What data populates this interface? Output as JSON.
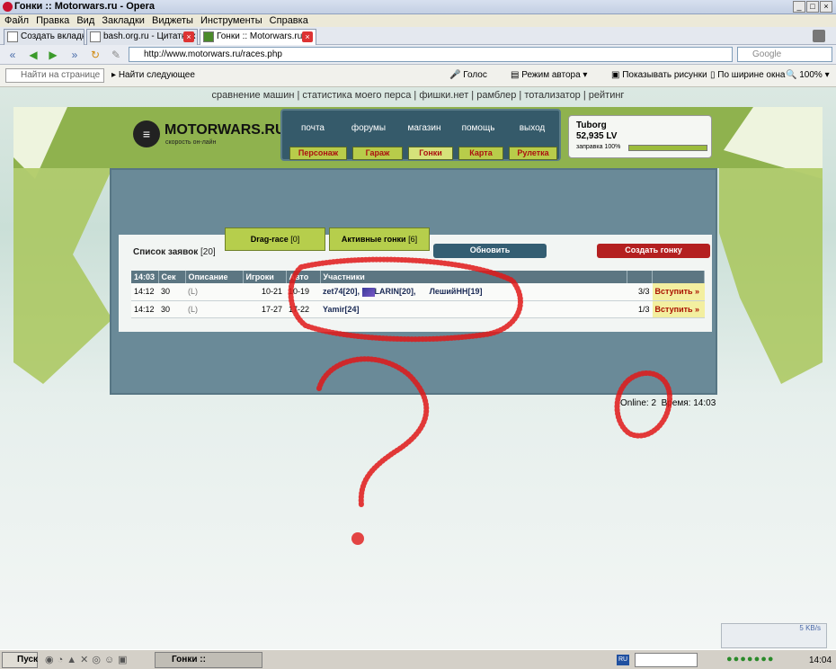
{
  "window": {
    "title": "Гонки :: Motorwars.ru - Opera"
  },
  "menu": [
    "Файл",
    "Правка",
    "Вид",
    "Закладки",
    "Виджеты",
    "Инструменты",
    "Справка"
  ],
  "tabs": [
    {
      "label": "Создать вкладку"
    },
    {
      "label": "bash.org.ru - Цитатник ..."
    },
    {
      "label": "Гонки :: Motorwars.ru"
    }
  ],
  "address": {
    "url": "http://www.motorwars.ru/races.php",
    "search_placeholder": "Google"
  },
  "toolbar2": {
    "find_placeholder": "Найти на странице",
    "find_next": "Найти следующее",
    "voice": "Голос",
    "author_mode": "Режим автора",
    "show_images": "Показывать рисунки",
    "fit_width": "По ширине окна",
    "zoom": "100%"
  },
  "site": {
    "top_links": [
      "сравнение машин",
      "статистика моего перса",
      "фишки.нет",
      "рамблер",
      "тотализатор",
      "рейтинг"
    ],
    "logo_name": "MOTORWARS.RU",
    "logo_sub": "скорость он-лайн",
    "nav_top": [
      "почта",
      "форумы",
      "магазин",
      "помощь",
      "выход"
    ],
    "nav_bottom": [
      "Персонаж",
      "Гараж",
      "Гонки",
      "Карта",
      "Рулетка"
    ],
    "user": {
      "name": "Tuborg",
      "lv": "52,935 LV",
      "fuel": "заправка 100%"
    }
  },
  "panel": {
    "list_label": "Список заявок",
    "list_count": "[20]",
    "drag_race": "Drag-race",
    "drag_count": "[0]",
    "active_races": "Активные гонки",
    "active_count": "[6]",
    "refresh": "Обновить",
    "create": "Создать гонку",
    "columns": [
      "14:03",
      "Сек",
      "Описание",
      "Игроки",
      "Авто",
      "Участники"
    ],
    "rows": [
      {
        "time": "14:12",
        "sec": "30",
        "desc": "(L)",
        "players": "10-21",
        "auto": "10-19",
        "p1": "zet74[20],",
        "p2": "LARIN[20],",
        "p3": "ЛешийНН[19]",
        "slots": "3/3",
        "join": "Вступить »"
      },
      {
        "time": "14:12",
        "sec": "30",
        "desc": "(L)",
        "players": "17-27",
        "auto": "17-22",
        "p1": "Yamir[24]",
        "p2": "",
        "p3": "",
        "slots": "1/3",
        "join": "Вступить »"
      }
    ],
    "online": "Online: 2",
    "time_label": "Время: 14:03"
  },
  "taskbar": {
    "start": "Пуск",
    "item": "Гонки :: Motorwars.ru...",
    "lang": "RU",
    "clock": "14:04",
    "speed": "5 KB/s"
  }
}
